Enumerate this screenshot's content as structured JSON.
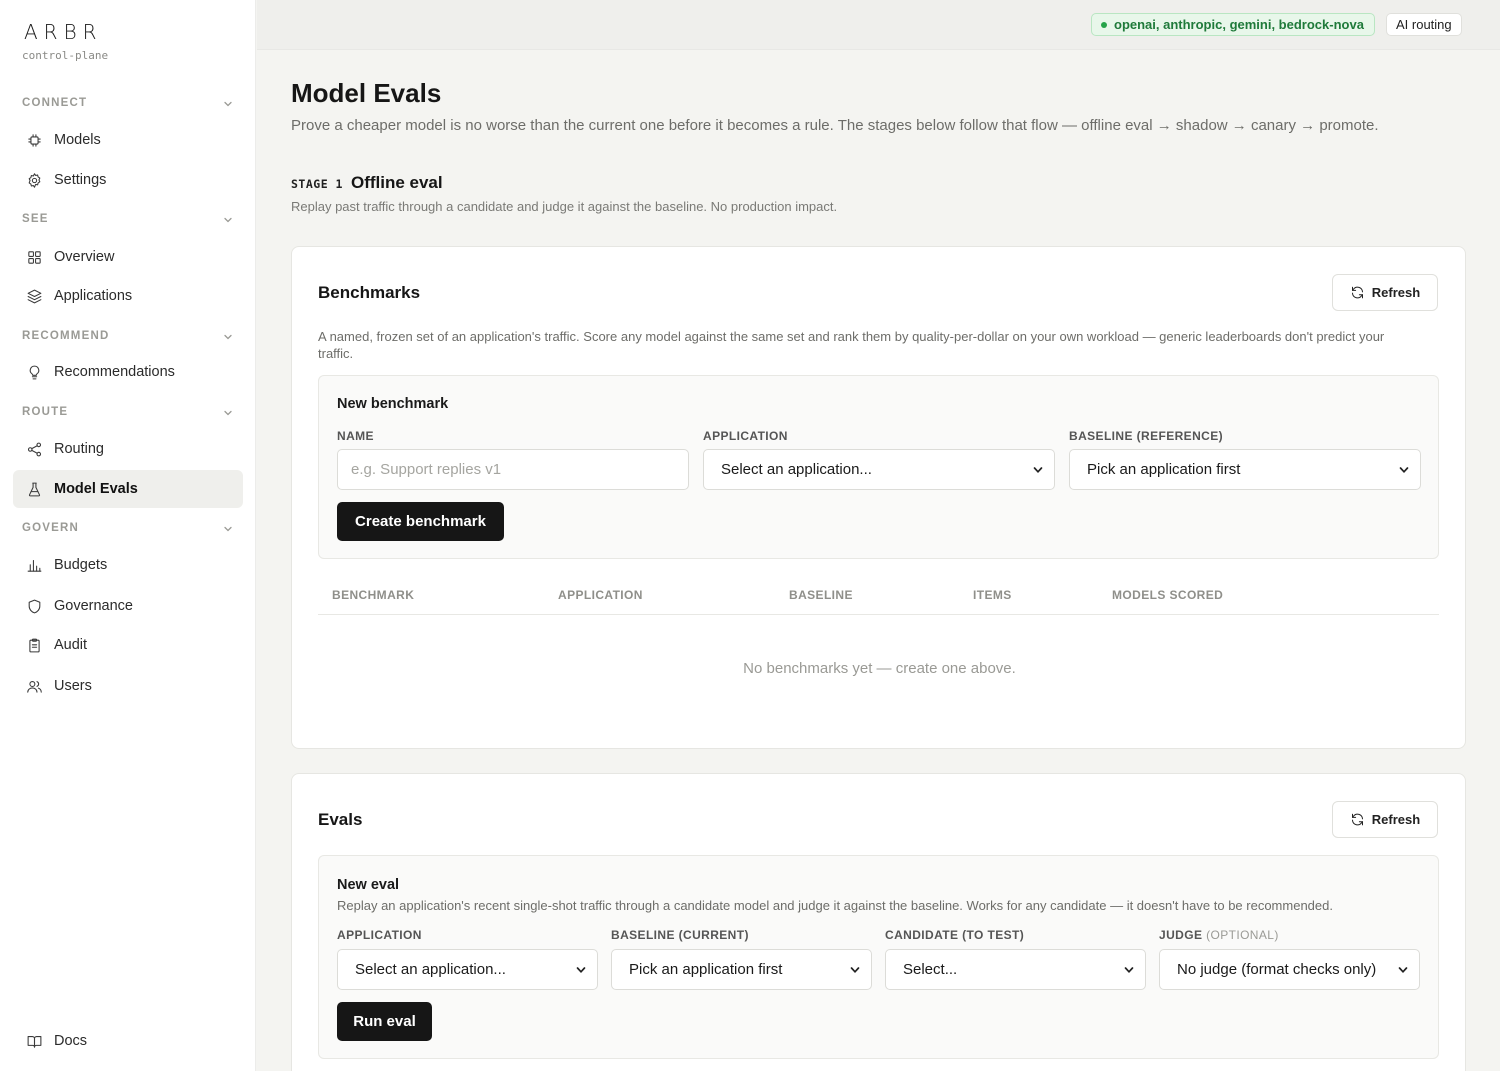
{
  "brand": {
    "logo": "ARBR",
    "subtitle": "control-plane"
  },
  "sidebar": {
    "sections": [
      {
        "label": "CONNECT"
      },
      {
        "label": "SEE"
      },
      {
        "label": "RECOMMEND"
      },
      {
        "label": "ROUTE"
      },
      {
        "label": "GOVERN"
      }
    ],
    "items": [
      {
        "label": "Models",
        "icon": "chip-icon"
      },
      {
        "label": "Settings",
        "icon": "gear-icon"
      },
      {
        "label": "Overview",
        "icon": "grid-icon"
      },
      {
        "label": "Applications",
        "icon": "layers-icon"
      },
      {
        "label": "Recommendations",
        "icon": "lightbulb-icon"
      },
      {
        "label": "Routing",
        "icon": "share-icon"
      },
      {
        "label": "Model Evals",
        "icon": "flask-icon",
        "active": true
      },
      {
        "label": "Budgets",
        "icon": "bar-chart-icon"
      },
      {
        "label": "Governance",
        "icon": "shield-icon"
      },
      {
        "label": "Audit",
        "icon": "clipboard-icon"
      },
      {
        "label": "Users",
        "icon": "users-icon"
      }
    ],
    "footer": {
      "label": "Docs",
      "icon": "book-icon"
    }
  },
  "topbar": {
    "providers": "openai, anthropic, gemini, bedrock-nova",
    "routing": "AI routing"
  },
  "page": {
    "title": "Model Evals",
    "subtitle": "Prove a cheaper model is no worse than the current one before it becomes a rule. The stages below follow that flow — offline eval → shadow → canary → promote.",
    "stage": {
      "tag": "STAGE 1",
      "name": "Offline eval",
      "desc": "Replay past traffic through a candidate and judge it against the baseline. No production impact."
    }
  },
  "benchmarks": {
    "title": "Benchmarks",
    "refresh": "Refresh",
    "desc": "A named, frozen set of an application's traffic. Score any model against the same set and rank them by quality-per-dollar on your own workload — generic leaderboards don't predict your traffic.",
    "form": {
      "title": "New benchmark",
      "name_label": "NAME",
      "name_placeholder": "e.g. Support replies v1",
      "application_label": "APPLICATION",
      "application_value": "Select an application...",
      "baseline_label": "BASELINE (REFERENCE)",
      "baseline_value": "Pick an application first",
      "submit": "Create benchmark"
    },
    "columns": [
      "BENCHMARK",
      "APPLICATION",
      "BASELINE",
      "ITEMS",
      "MODELS SCORED"
    ],
    "empty": "No benchmarks yet — create one above."
  },
  "evals": {
    "title": "Evals",
    "refresh": "Refresh",
    "form": {
      "title": "New eval",
      "desc": "Replay an application's recent single-shot traffic through a candidate model and judge it against the baseline. Works for any candidate — it doesn't have to be recommended.",
      "application_label": "APPLICATION",
      "application_value": "Select an application...",
      "baseline_label": "BASELINE (CURRENT)",
      "baseline_value": "Pick an application first",
      "candidate_label": "CANDIDATE (TO TEST)",
      "candidate_value": "Select...",
      "judge_label": "JUDGE",
      "judge_optional": "(OPTIONAL)",
      "judge_value": "No judge (format checks only)",
      "submit": "Run eval"
    }
  }
}
